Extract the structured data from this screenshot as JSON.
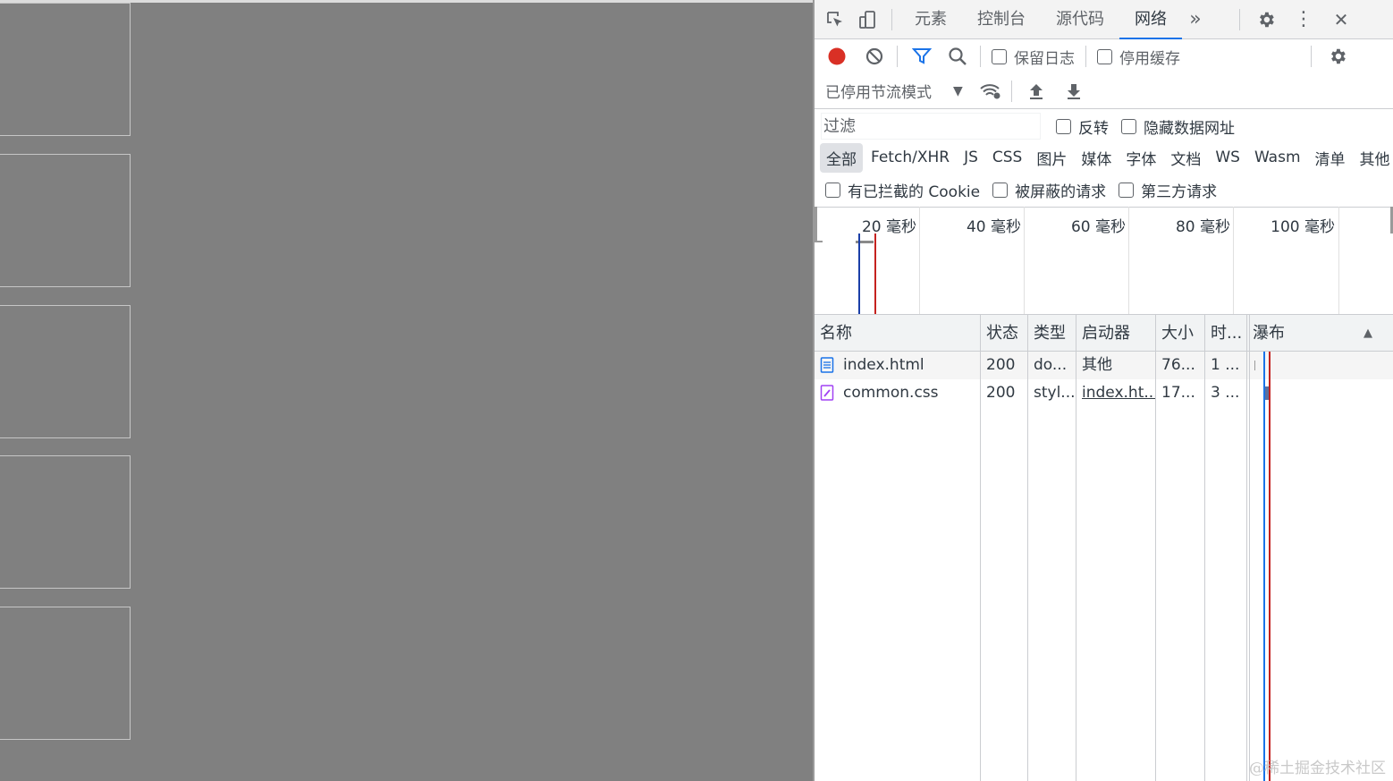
{
  "devtools": {
    "tabs": [
      "元素",
      "控制台",
      "源代码",
      "网络"
    ],
    "active_tab": "网络",
    "more_tabs_glyph": "»",
    "close_glyph": "✕",
    "kebab_glyph": "⋮"
  },
  "toolbar": {
    "preserve_log": "保留日志",
    "disable_cache": "停用缓存",
    "throttling": "已停用节流模式",
    "throttling_arrow": "▼"
  },
  "filter": {
    "placeholder": "过滤",
    "invert": "反转",
    "hide_data_urls": "隐藏数据网址"
  },
  "type_filters": [
    "全部",
    "Fetch/XHR",
    "JS",
    "CSS",
    "图片",
    "媒体",
    "字体",
    "文档",
    "WS",
    "Wasm",
    "清单",
    "其他"
  ],
  "cookie_filters": {
    "blocked_cookies": "有已拦截的 Cookie",
    "blocked_requests": "被屏蔽的请求",
    "third_party": "第三方请求"
  },
  "overview": {
    "labels": [
      "20 毫秒",
      "40 毫秒",
      "60 毫秒",
      "80 毫秒",
      "100 毫秒"
    ]
  },
  "table": {
    "headers": {
      "name": "名称",
      "status": "状态",
      "type": "类型",
      "initiator": "启动器",
      "size": "大小",
      "time": "时...",
      "waterfall": "瀑布",
      "sort_glyph": "▲"
    },
    "rows": [
      {
        "name": "index.html",
        "status": "200",
        "type": "do...",
        "initiator": "其他",
        "size": "76...",
        "time": "1 ..."
      },
      {
        "name": "common.css",
        "status": "200",
        "type": "styl...",
        "initiator": "index.ht...",
        "size": "17...",
        "time": "3 ..."
      }
    ]
  },
  "colors": {
    "accent": "#1a73e8",
    "record": "#d93025",
    "dom_content_loaded": "#1a3fa8",
    "load": "#c5221f"
  },
  "watermark": "@稀土掘金技术社区"
}
